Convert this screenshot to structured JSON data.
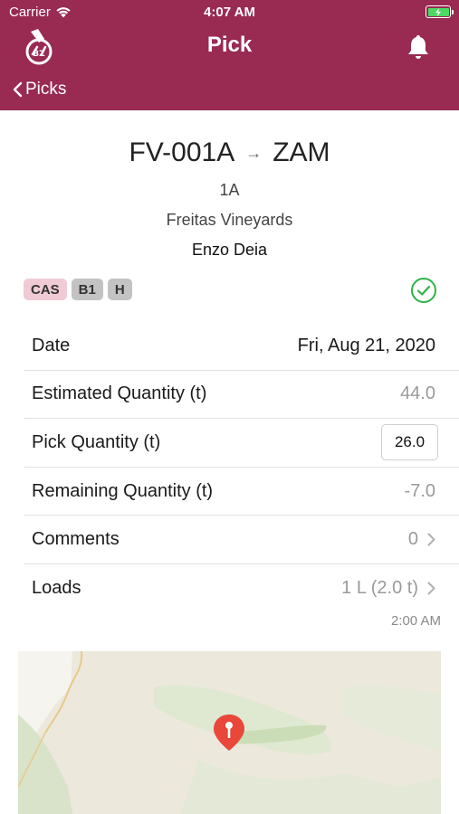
{
  "status_bar": {
    "carrier": "Carrier",
    "time": "4:07 AM"
  },
  "nav": {
    "title": "Pick",
    "back_label": "Picks"
  },
  "pick": {
    "source": "FV-001A",
    "destination": "ZAM",
    "block": "1A",
    "vineyard": "Freitas Vineyards",
    "grower": "Enzo Deia"
  },
  "tags": [
    "CAS",
    "B1",
    "H"
  ],
  "fields": {
    "date_label": "Date",
    "date_value": "Fri, Aug 21, 2020",
    "estimated_label": "Estimated Quantity (t)",
    "estimated_value": "44.0",
    "pick_label": "Pick Quantity (t)",
    "pick_value": "26.0",
    "remaining_label": "Remaining Quantity (t)",
    "remaining_value": "-7.0",
    "comments_label": "Comments",
    "comments_value": "0",
    "loads_label": "Loads",
    "loads_value": "1 L (2.0 t)"
  },
  "load_time": "2:00 AM",
  "colors": {
    "header": "#992a52",
    "tag_cas": "#f0cbd5",
    "tag_gray": "#c3c3c3",
    "check": "#2fb34a",
    "map_pin": "#e8473a"
  }
}
